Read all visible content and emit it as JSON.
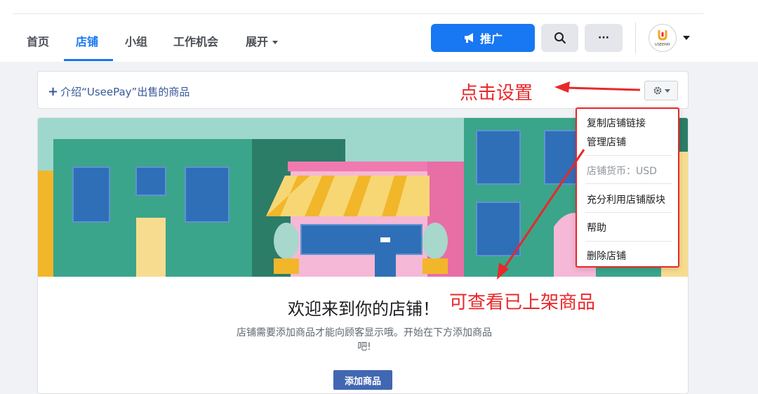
{
  "nav": {
    "tabs": [
      {
        "label": "首页",
        "active": false
      },
      {
        "label": "店铺",
        "active": true
      },
      {
        "label": "小组",
        "active": false
      },
      {
        "label": "工作机会",
        "active": false
      },
      {
        "label": "展开",
        "active": false,
        "has_caret": true
      }
    ],
    "promote_label": "推广",
    "promote_icon": "megaphone-icon",
    "search_icon": "search-icon",
    "more_label": "···",
    "avatar_text": "USEEPAY",
    "accent": "#1877f2"
  },
  "intro": {
    "link_prefix": "+",
    "link_text": "介绍“UseePay”出售的商品",
    "gear_icon": "gear-icon"
  },
  "menu": {
    "items": [
      {
        "label": "复制店铺链接",
        "enabled": true
      },
      {
        "label": "管理店铺",
        "enabled": true
      },
      {
        "label": "店铺货币：USD",
        "enabled": false
      },
      {
        "label": "充分利用店铺版块",
        "enabled": true
      },
      {
        "label": "帮助",
        "enabled": true
      },
      {
        "label": "删除店铺",
        "enabled": true
      }
    ]
  },
  "shop": {
    "welcome": "欢迎来到你的店铺！",
    "subtitle": "店铺需要添加商品才能向顾客显示哦。开始在下方添加商品吧!",
    "add_button": "添加商品"
  },
  "annotations": {
    "click_settings": "点击设置",
    "view_products": "可查看已上架商品",
    "color": "#e8282b"
  }
}
